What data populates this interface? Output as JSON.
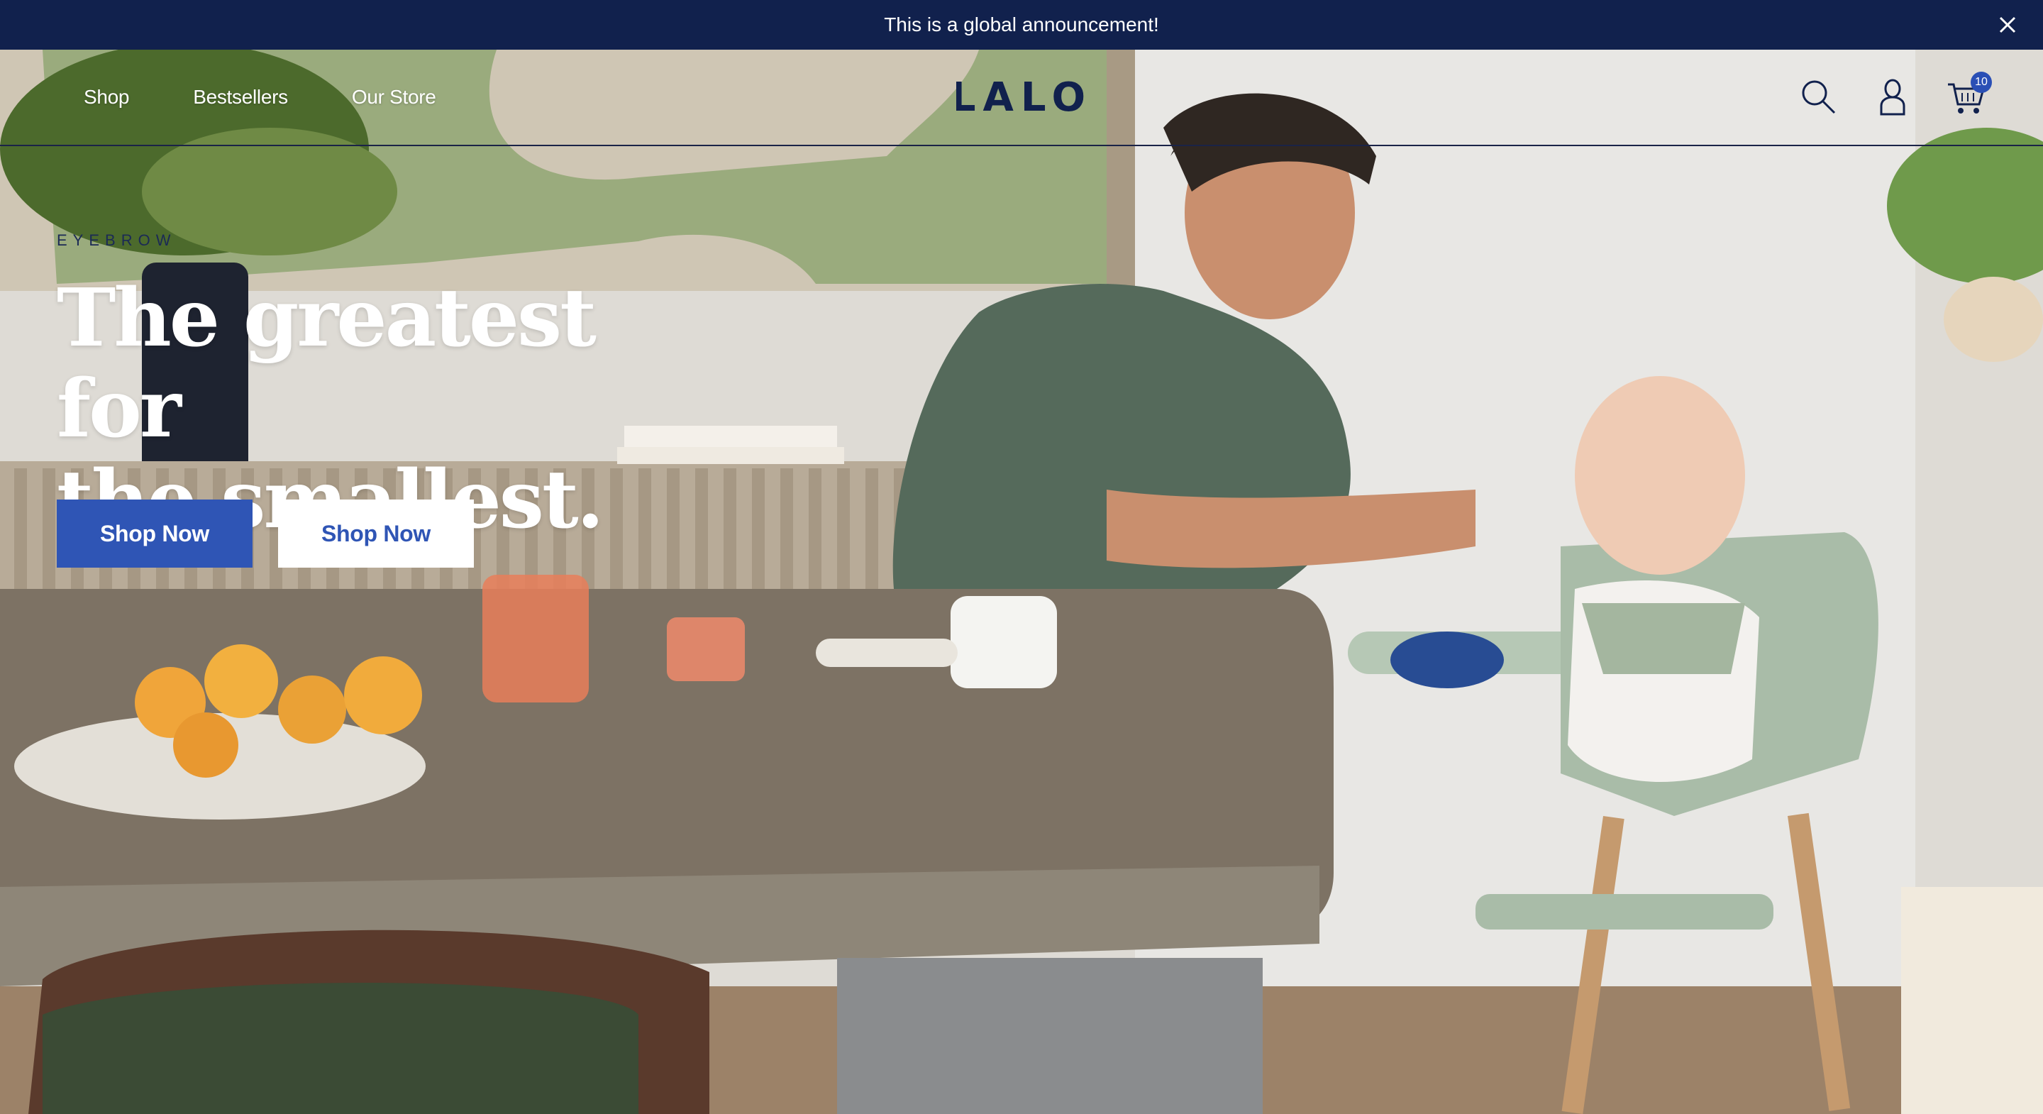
{
  "announcement": {
    "text": "This is a global announcement!",
    "close_icon": "close-icon"
  },
  "nav": {
    "items": [
      {
        "label": "Shop"
      },
      {
        "label": "Bestsellers"
      },
      {
        "label": "Our Store"
      }
    ]
  },
  "brand": {
    "logo_text": "LALO",
    "color": "#11214d"
  },
  "header_icons": {
    "search_icon": "search-icon",
    "account_icon": "user-icon",
    "cart_icon": "cart-icon",
    "cart_count": "10"
  },
  "hero": {
    "eyebrow": "EYEBROW",
    "headline_line1": "The greatest for",
    "headline_line2": "the smallest.",
    "primary_cta": "Shop Now",
    "secondary_cta": "Shop Now"
  },
  "colors": {
    "announcement_bg": "#11214d",
    "primary_button": "#2f55b5",
    "secondary_button_bg": "#ffffff"
  }
}
